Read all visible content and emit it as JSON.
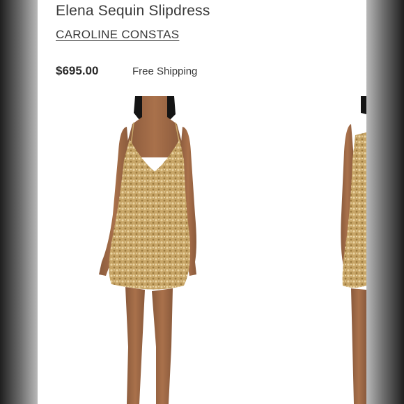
{
  "product": {
    "title": "Elena Sequin Slipdress",
    "brand": "CAROLINE CONSTAS",
    "price": "$695.00",
    "shipping": "Free Shipping"
  },
  "images": {
    "main": "model-photo-gold-sequin-slipdress",
    "next": "model-photo-gold-sequin-slipdress-peek"
  },
  "colors": {
    "background": "#ffffff",
    "text": "#3a3a3a",
    "dress_gold": "#c9a86a"
  }
}
